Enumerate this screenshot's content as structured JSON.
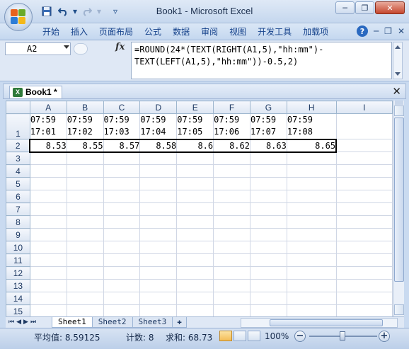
{
  "app": {
    "title": "Book1 - Microsoft Excel",
    "close_glyph": "✕",
    "restore_glyph": "❐",
    "minimize_glyph": "─"
  },
  "quick_access": {
    "save_icon": "save-icon",
    "undo_icon": "undo-icon",
    "redo_icon": "redo-icon",
    "customize_icon": "customize-dropdown-icon"
  },
  "ribbon": {
    "tabs": [
      "开始",
      "插入",
      "页面布局",
      "公式",
      "数据",
      "审阅",
      "视图",
      "开发工具",
      "加载项"
    ],
    "help_glyph": "?"
  },
  "formula_bar": {
    "name_box": "A2",
    "fx_label": "fx",
    "formula_line1": "=ROUND(24*(TEXT(RIGHT(A1,5),\"hh:mm\")-",
    "formula_line2": "TEXT(LEFT(A1,5),\"hh:mm\"))-0.5,2)"
  },
  "workbook": {
    "tab_label": "Book1 *",
    "close_glyph": "✕"
  },
  "sheet": {
    "columns": [
      "A",
      "B",
      "C",
      "D",
      "E",
      "F",
      "G",
      "H",
      "I"
    ],
    "rows": [
      "1",
      "2",
      "3",
      "4",
      "5",
      "6",
      "7",
      "8",
      "9",
      "10",
      "11",
      "12",
      "13",
      "14",
      "15"
    ],
    "row1": [
      [
        "07:59",
        "17:01"
      ],
      [
        "07:59",
        "17:02"
      ],
      [
        "07:59",
        "17:03"
      ],
      [
        "07:59",
        "17:04"
      ],
      [
        "07:59",
        "17:05"
      ],
      [
        "07:59",
        "17:06"
      ],
      [
        "07:59",
        "17:07"
      ],
      [
        "07:59",
        "17:08"
      ]
    ],
    "row2": [
      "8.53",
      "8.55",
      "8.57",
      "8.58",
      "8.6",
      "8.62",
      "8.63",
      "8.65"
    ],
    "selected_row": "2",
    "selected_columns": [
      "A",
      "B",
      "C",
      "D",
      "E",
      "F",
      "G",
      "H"
    ]
  },
  "sheet_tabs": [
    "Sheet1",
    "Sheet2",
    "Sheet3"
  ],
  "status": {
    "average": "平均值: 8.59125",
    "count": "计数: 8",
    "sum": "求和: 68.73",
    "zoom": "100%",
    "zoom_level_percent": 100
  }
}
